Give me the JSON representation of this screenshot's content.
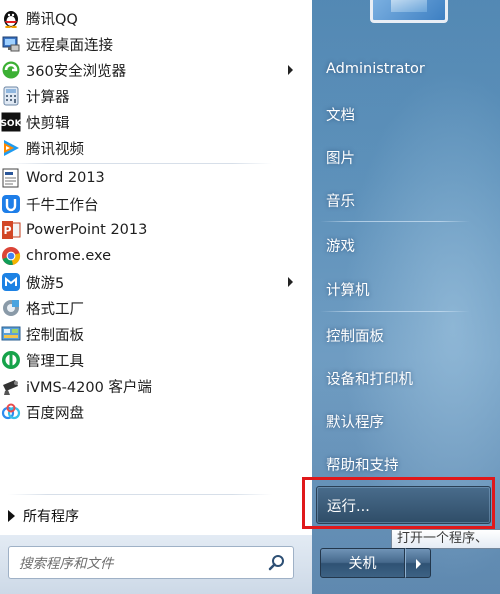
{
  "programs": [
    {
      "label": "腾讯QQ",
      "icon": "qq-penguin-icon"
    },
    {
      "label": "远程桌面连接",
      "icon": "remote-desktop-icon"
    },
    {
      "label": "360安全浏览器",
      "icon": "360-browser-icon"
    },
    {
      "label": "计算器",
      "icon": "calculator-icon"
    },
    {
      "label": "快剪辑",
      "icon": "kuaijianji-icon"
    },
    {
      "label": "腾讯视频",
      "icon": "tencent-video-icon"
    },
    {
      "label": "Word 2013",
      "icon": "word-icon"
    },
    {
      "label": "千牛工作台",
      "icon": "qianniu-icon"
    },
    {
      "label": "PowerPoint 2013",
      "icon": "powerpoint-icon"
    },
    {
      "label": "chrome.exe",
      "icon": "chrome-icon"
    },
    {
      "label": "傲游5",
      "icon": "maxthon-icon"
    },
    {
      "label": "格式工厂",
      "icon": "format-factory-icon"
    },
    {
      "label": "控制面板",
      "icon": "control-panel-icon"
    },
    {
      "label": "管理工具",
      "icon": "admin-tools-icon"
    },
    {
      "label": "iVMS-4200 客户端",
      "icon": "ivms-camera-icon"
    },
    {
      "label": "百度网盘",
      "icon": "baidu-netdisk-icon"
    }
  ],
  "all_programs": "所有程序",
  "search": {
    "placeholder": "搜索程序和文件"
  },
  "right_items": {
    "user": "Administrator",
    "documents": "文档",
    "pictures": "图片",
    "music": "音乐",
    "games": "游戏",
    "computer": "计算机",
    "control_panel": "控制面板",
    "devices": "设备和打印机",
    "default_programs": "默认程序",
    "help": "帮助和支持",
    "run": "运行..."
  },
  "tooltip": "打开一个程序、",
  "shutdown": "关机",
  "colors": {
    "highlight": "#e0181b",
    "panel": "#5a8fb9"
  }
}
